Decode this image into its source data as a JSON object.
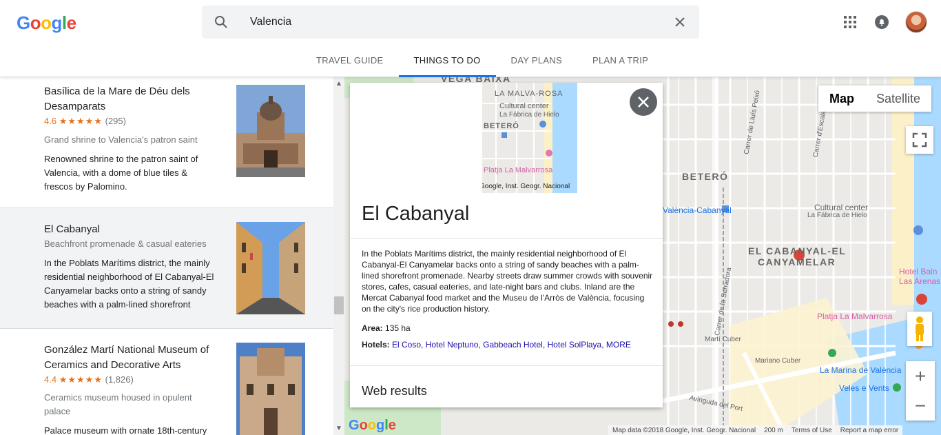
{
  "header": {
    "logo": "Google",
    "search_value": "Valencia",
    "tabs": [
      "TRAVEL GUIDE",
      "THINGS TO DO",
      "DAY PLANS",
      "PLAN A TRIP"
    ],
    "active_tab": "THINGS TO DO"
  },
  "list": [
    {
      "title": "Basílica de la Mare de Déu dels Desamparats",
      "rating": "4.6",
      "stars": "★★★★★",
      "reviews": "(295)",
      "subtitle": "Grand shrine to Valencia's patron saint",
      "description": "Renowned shrine to the patron saint of Valencia, with a dome of blue tiles & frescos by Palomino."
    },
    {
      "title": "El Cabanyal",
      "subtitle": "Beachfront promenade & casual eateries",
      "description": "In the Poblats Marítims district, the mainly residential neighborhood of El Cabanyal-El Canyamelar backs onto a string of sandy beaches with a palm-lined shorefront"
    },
    {
      "title": "González Martí National Museum of Ceramics and Decorative Arts",
      "rating": "4.4",
      "stars": "★★★★★",
      "reviews": "(1,826)",
      "subtitle": "Ceramics museum housed in opulent palace",
      "description": "Palace museum with ornate 18th-century"
    }
  ],
  "card": {
    "title": "El Cabanyal",
    "mini_map_labels": [
      "LA MALVA-ROSA",
      "Cultural center",
      "La Fábrica de Hielo",
      "BETERÓ",
      "Platja La Malvarrosa",
      "Google, Inst. Geogr. Nacional"
    ],
    "description": "In the Poblats Marítims district, the mainly residential neighborhood of El Cabanyal-El Canyamelar backs onto a string of sandy beaches with a palm-lined shorefront promenade. Nearby streets draw summer crowds with souvenir stores, cafes, casual eateries, and late-night bars and clubs. Inland are the Mercat Cabanyal food market and the Museu de l'Arròs de València, focusing on the city's rice production history.",
    "area_label": "Area:",
    "area_value": "135 ha",
    "hotels_label": "Hotels:",
    "hotels": [
      "El Coso",
      "Hotel Neptuno",
      "Gabbeach Hotel",
      "Hotel SolPlaya"
    ],
    "more": "MORE",
    "web_results": "Web results"
  },
  "map": {
    "type_buttons": [
      "Map",
      "Satellite"
    ],
    "active_type": "Map",
    "labels": {
      "vega_baixa": "VEGA BAIXA",
      "betero": "BETERÓ",
      "cabanyal": "EL CABANYAL-EL",
      "canyamelar": "CANYAMELAR",
      "cultural": "Cultural center",
      "fabrica": "La Fábrica de Hielo",
      "station": "València-Cabanyal",
      "platja": "Platja La Malvarrosa",
      "hotel_balneario": "Hotel Baln",
      "las_arenas": "Las Arenas",
      "marina": "La Marina de València",
      "veles": "Veles e Vents",
      "av_puerto": "Avinguda del Port",
      "serradora": "Carrer de la Serradora",
      "lluis": "Carrer de Lluís Peixó",
      "escalante": "Carrer d'Escalante",
      "marti_cuber": "Martí Cuber",
      "mariano": "Mariano Cuber"
    },
    "glogo": "Google",
    "footer": {
      "data": "Map data ©2018 Google, Inst. Geogr. Nacional",
      "scale": "200 m",
      "terms": "Terms of Use",
      "report": "Report a map error"
    },
    "zoom_in": "+",
    "zoom_out": "−"
  },
  "colors": {
    "accent": "#1a73e8",
    "star": "#e7711b",
    "link": "#1a0dab",
    "poi_red": "#db4437"
  }
}
